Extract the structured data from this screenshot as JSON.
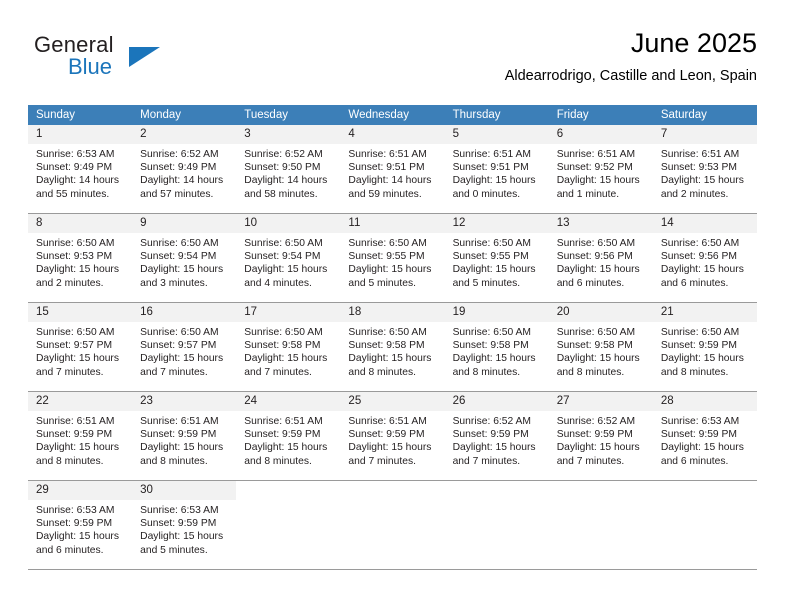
{
  "brand": {
    "word_one": "General",
    "word_two": "Blue",
    "accent_color": "#1b75bb",
    "triangle_icon": "brand-triangle-icon"
  },
  "header": {
    "title": "June 2025",
    "subtitle": "Aldearrodrigo, Castille and Leon, Spain"
  },
  "colors": {
    "header_band": "#3c7fb8",
    "daynum_band": "#f2f2f2",
    "grid_line": "#9a9a9a",
    "text": "#231f20"
  },
  "weekdays": [
    "Sunday",
    "Monday",
    "Tuesday",
    "Wednesday",
    "Thursday",
    "Friday",
    "Saturday"
  ],
  "weeks": [
    [
      {
        "day": "1",
        "sunrise": "Sunrise: 6:53 AM",
        "sunset": "Sunset: 9:49 PM",
        "daylight": "Daylight: 14 hours and 55 minutes."
      },
      {
        "day": "2",
        "sunrise": "Sunrise: 6:52 AM",
        "sunset": "Sunset: 9:49 PM",
        "daylight": "Daylight: 14 hours and 57 minutes."
      },
      {
        "day": "3",
        "sunrise": "Sunrise: 6:52 AM",
        "sunset": "Sunset: 9:50 PM",
        "daylight": "Daylight: 14 hours and 58 minutes."
      },
      {
        "day": "4",
        "sunrise": "Sunrise: 6:51 AM",
        "sunset": "Sunset: 9:51 PM",
        "daylight": "Daylight: 14 hours and 59 minutes."
      },
      {
        "day": "5",
        "sunrise": "Sunrise: 6:51 AM",
        "sunset": "Sunset: 9:51 PM",
        "daylight": "Daylight: 15 hours and 0 minutes."
      },
      {
        "day": "6",
        "sunrise": "Sunrise: 6:51 AM",
        "sunset": "Sunset: 9:52 PM",
        "daylight": "Daylight: 15 hours and 1 minute."
      },
      {
        "day": "7",
        "sunrise": "Sunrise: 6:51 AM",
        "sunset": "Sunset: 9:53 PM",
        "daylight": "Daylight: 15 hours and 2 minutes."
      }
    ],
    [
      {
        "day": "8",
        "sunrise": "Sunrise: 6:50 AM",
        "sunset": "Sunset: 9:53 PM",
        "daylight": "Daylight: 15 hours and 2 minutes."
      },
      {
        "day": "9",
        "sunrise": "Sunrise: 6:50 AM",
        "sunset": "Sunset: 9:54 PM",
        "daylight": "Daylight: 15 hours and 3 minutes."
      },
      {
        "day": "10",
        "sunrise": "Sunrise: 6:50 AM",
        "sunset": "Sunset: 9:54 PM",
        "daylight": "Daylight: 15 hours and 4 minutes."
      },
      {
        "day": "11",
        "sunrise": "Sunrise: 6:50 AM",
        "sunset": "Sunset: 9:55 PM",
        "daylight": "Daylight: 15 hours and 5 minutes."
      },
      {
        "day": "12",
        "sunrise": "Sunrise: 6:50 AM",
        "sunset": "Sunset: 9:55 PM",
        "daylight": "Daylight: 15 hours and 5 minutes."
      },
      {
        "day": "13",
        "sunrise": "Sunrise: 6:50 AM",
        "sunset": "Sunset: 9:56 PM",
        "daylight": "Daylight: 15 hours and 6 minutes."
      },
      {
        "day": "14",
        "sunrise": "Sunrise: 6:50 AM",
        "sunset": "Sunset: 9:56 PM",
        "daylight": "Daylight: 15 hours and 6 minutes."
      }
    ],
    [
      {
        "day": "15",
        "sunrise": "Sunrise: 6:50 AM",
        "sunset": "Sunset: 9:57 PM",
        "daylight": "Daylight: 15 hours and 7 minutes."
      },
      {
        "day": "16",
        "sunrise": "Sunrise: 6:50 AM",
        "sunset": "Sunset: 9:57 PM",
        "daylight": "Daylight: 15 hours and 7 minutes."
      },
      {
        "day": "17",
        "sunrise": "Sunrise: 6:50 AM",
        "sunset": "Sunset: 9:58 PM",
        "daylight": "Daylight: 15 hours and 7 minutes."
      },
      {
        "day": "18",
        "sunrise": "Sunrise: 6:50 AM",
        "sunset": "Sunset: 9:58 PM",
        "daylight": "Daylight: 15 hours and 8 minutes."
      },
      {
        "day": "19",
        "sunrise": "Sunrise: 6:50 AM",
        "sunset": "Sunset: 9:58 PM",
        "daylight": "Daylight: 15 hours and 8 minutes."
      },
      {
        "day": "20",
        "sunrise": "Sunrise: 6:50 AM",
        "sunset": "Sunset: 9:58 PM",
        "daylight": "Daylight: 15 hours and 8 minutes."
      },
      {
        "day": "21",
        "sunrise": "Sunrise: 6:50 AM",
        "sunset": "Sunset: 9:59 PM",
        "daylight": "Daylight: 15 hours and 8 minutes."
      }
    ],
    [
      {
        "day": "22",
        "sunrise": "Sunrise: 6:51 AM",
        "sunset": "Sunset: 9:59 PM",
        "daylight": "Daylight: 15 hours and 8 minutes."
      },
      {
        "day": "23",
        "sunrise": "Sunrise: 6:51 AM",
        "sunset": "Sunset: 9:59 PM",
        "daylight": "Daylight: 15 hours and 8 minutes."
      },
      {
        "day": "24",
        "sunrise": "Sunrise: 6:51 AM",
        "sunset": "Sunset: 9:59 PM",
        "daylight": "Daylight: 15 hours and 8 minutes."
      },
      {
        "day": "25",
        "sunrise": "Sunrise: 6:51 AM",
        "sunset": "Sunset: 9:59 PM",
        "daylight": "Daylight: 15 hours and 7 minutes."
      },
      {
        "day": "26",
        "sunrise": "Sunrise: 6:52 AM",
        "sunset": "Sunset: 9:59 PM",
        "daylight": "Daylight: 15 hours and 7 minutes."
      },
      {
        "day": "27",
        "sunrise": "Sunrise: 6:52 AM",
        "sunset": "Sunset: 9:59 PM",
        "daylight": "Daylight: 15 hours and 7 minutes."
      },
      {
        "day": "28",
        "sunrise": "Sunrise: 6:53 AM",
        "sunset": "Sunset: 9:59 PM",
        "daylight": "Daylight: 15 hours and 6 minutes."
      }
    ],
    [
      {
        "day": "29",
        "sunrise": "Sunrise: 6:53 AM",
        "sunset": "Sunset: 9:59 PM",
        "daylight": "Daylight: 15 hours and 6 minutes."
      },
      {
        "day": "30",
        "sunrise": "Sunrise: 6:53 AM",
        "sunset": "Sunset: 9:59 PM",
        "daylight": "Daylight: 15 hours and 5 minutes."
      },
      {
        "day": "",
        "sunrise": "",
        "sunset": "",
        "daylight": ""
      },
      {
        "day": "",
        "sunrise": "",
        "sunset": "",
        "daylight": ""
      },
      {
        "day": "",
        "sunrise": "",
        "sunset": "",
        "daylight": ""
      },
      {
        "day": "",
        "sunrise": "",
        "sunset": "",
        "daylight": ""
      },
      {
        "day": "",
        "sunrise": "",
        "sunset": "",
        "daylight": ""
      }
    ]
  ]
}
